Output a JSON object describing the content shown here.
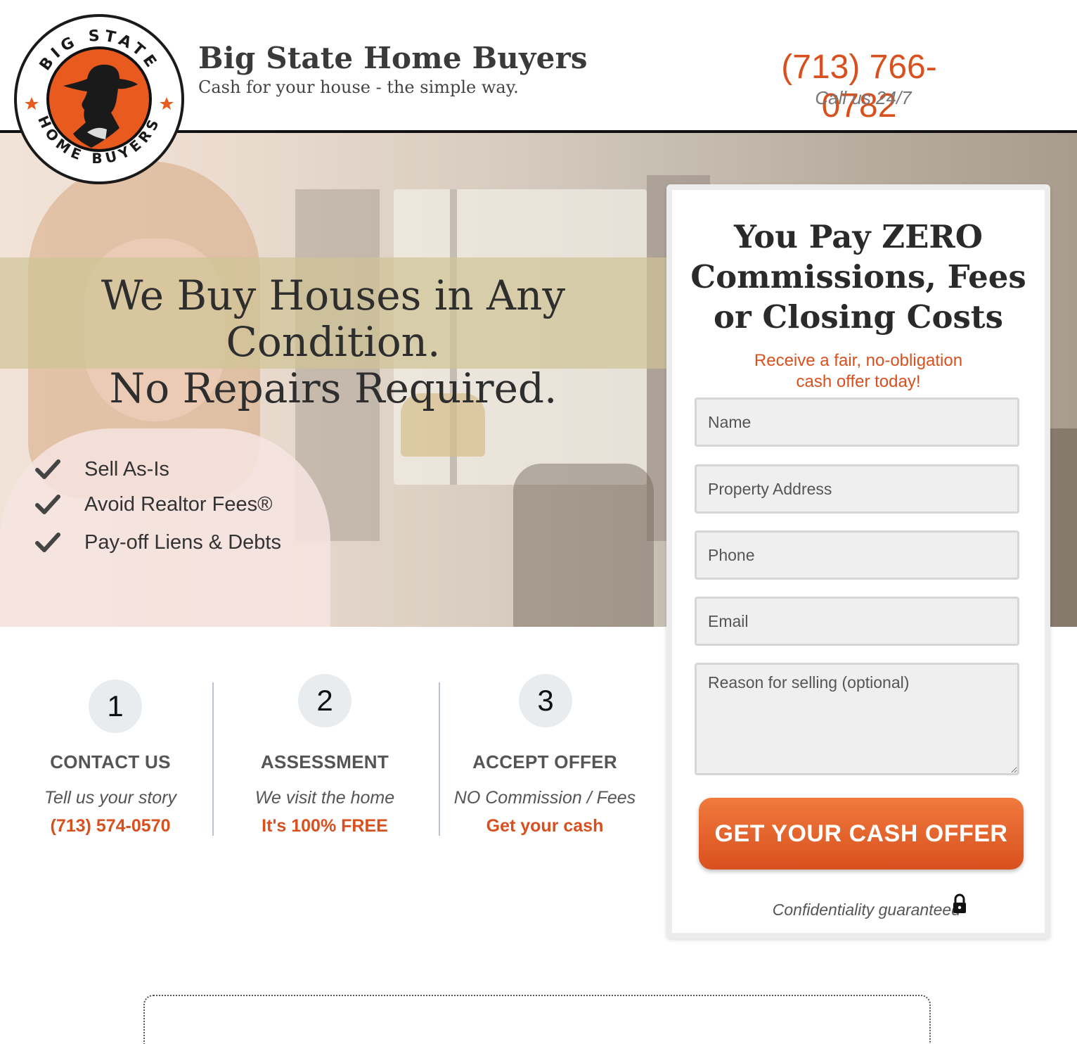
{
  "header": {
    "brand_name": "Big State Home Buyers",
    "tagline": "Cash for your house - the simple way.",
    "phone": "(713) 766-0782",
    "call_note": "Call us 24/7"
  },
  "logo": {
    "top_text": "BIG STATE",
    "bottom_text": "HOME BUYERS",
    "colors": {
      "ring": "#111111",
      "disc": "#e85a1e",
      "star": "#e85a1e"
    }
  },
  "hero": {
    "headline_line1": "We Buy Houses in Any Condition.",
    "headline_line2": "No Repairs Required.",
    "benefits": [
      "Sell As-Is",
      "Avoid Realtor Fees®",
      "Pay-off Liens & Debts"
    ]
  },
  "steps": [
    {
      "number": "1",
      "title": "CONTACT US",
      "desc": "Tell us your story",
      "link": "(713) 574-0570"
    },
    {
      "number": "2",
      "title": "ASSESSMENT",
      "desc": "We visit the home",
      "link": "It's 100% FREE"
    },
    {
      "number": "3",
      "title": "ACCEPT OFFER",
      "desc": "NO Commission / Fees",
      "link": "Get your cash"
    }
  ],
  "form": {
    "title_line1": "You Pay ZERO",
    "title_line2": "Commissions, Fees",
    "title_line3": "or Closing Costs",
    "sub_line1": "Receive a fair, no-obligation",
    "sub_line2": "cash offer today!",
    "placeholders": {
      "name": "Name",
      "address": "Property Address",
      "phone": "Phone",
      "email": "Email",
      "reason": "Reason for selling (optional)"
    },
    "submit_label": "GET YOUR CASH OFFER",
    "confidentiality": "Confidentiality guaranteed"
  },
  "colors": {
    "accent": "#d9501f",
    "dark": "#2a2a2a"
  },
  "icons": {
    "check": "checkmark-icon",
    "lock": "lock-icon"
  }
}
